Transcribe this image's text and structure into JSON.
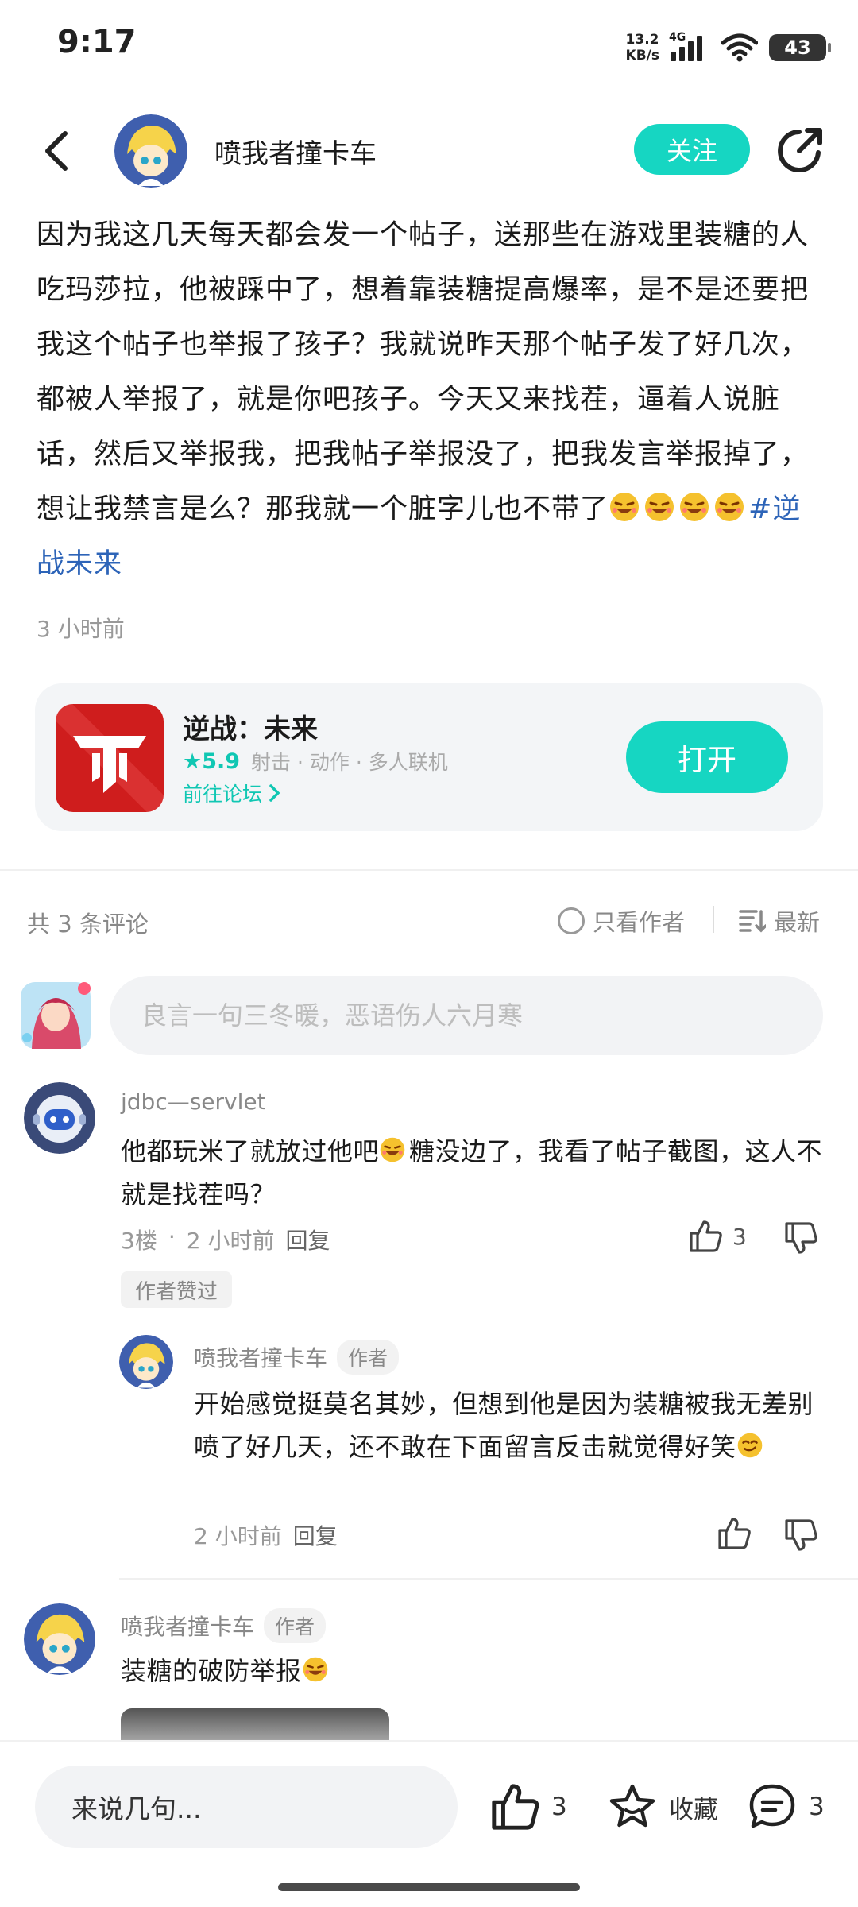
{
  "status_bar": {
    "time": "9:17",
    "net_speed_value": "13.2",
    "net_speed_unit": "KB/s",
    "network_type": "4G",
    "battery": "43"
  },
  "header": {
    "author_name": "喷我者撞卡车",
    "follow_label": "关注"
  },
  "post": {
    "body": "因为我这几天每天都会发一个帖子，送那些在游戏里装糖的人吃玛莎拉，他被踩中了，想着靠装糖提高爆率，是不是还要把我这个帖子也举报了孩子？我就说昨天那个帖子发了好几次，都被人举报了，就是你吧孩子。今天又来找茬，逼着人说脏话，然后又举报我，把我帖子举报没了，把我发言举报掉了，想让我禁言是么？那我就一个脏字儿也不带了",
    "emoji_count": 4,
    "hashtag": "#逆战未来",
    "time": "3 小时前"
  },
  "app_card": {
    "name": "逆战：未来",
    "rating": "★5.9",
    "tags": "射击 · 动作 · 多人联机",
    "forum_link": "前往论坛",
    "open_label": "打开",
    "icon_color": "#d31f1f"
  },
  "comments_header": {
    "count": "共 3 条评论",
    "author_only": "只看作者",
    "sort": "最新"
  },
  "comment_input": {
    "placeholder": "良言一句三冬暖，恶语伤人六月寒"
  },
  "comments": [
    {
      "name": "jdbc—servlet",
      "text_before": "他都玩米了就放过他吧",
      "text_after": "糖没边了，我看了帖子截图，这人不就是找茬吗？",
      "floor": "3楼",
      "time": "2 小时前",
      "reply": "回复",
      "likes": "3",
      "badge": "作者赞过"
    },
    {
      "name": "喷我者撞卡车",
      "tag": "作者",
      "text": "开始感觉挺莫名其妙，但想到他是因为装糖被我无差别喷了好几天，还不敢在下面留言反击就觉得好笑",
      "time": "2 小时前",
      "reply": "回复"
    },
    {
      "name": "喷我者撞卡车",
      "tag": "作者",
      "text": "装糖的破防举报"
    }
  ],
  "bottom_bar": {
    "input_placeholder": "来说几句...",
    "likes": "3",
    "favorite_label": "收藏",
    "comments": "3"
  },
  "colors": {
    "accent": "#16d6c2",
    "link": "#2d64b8"
  }
}
